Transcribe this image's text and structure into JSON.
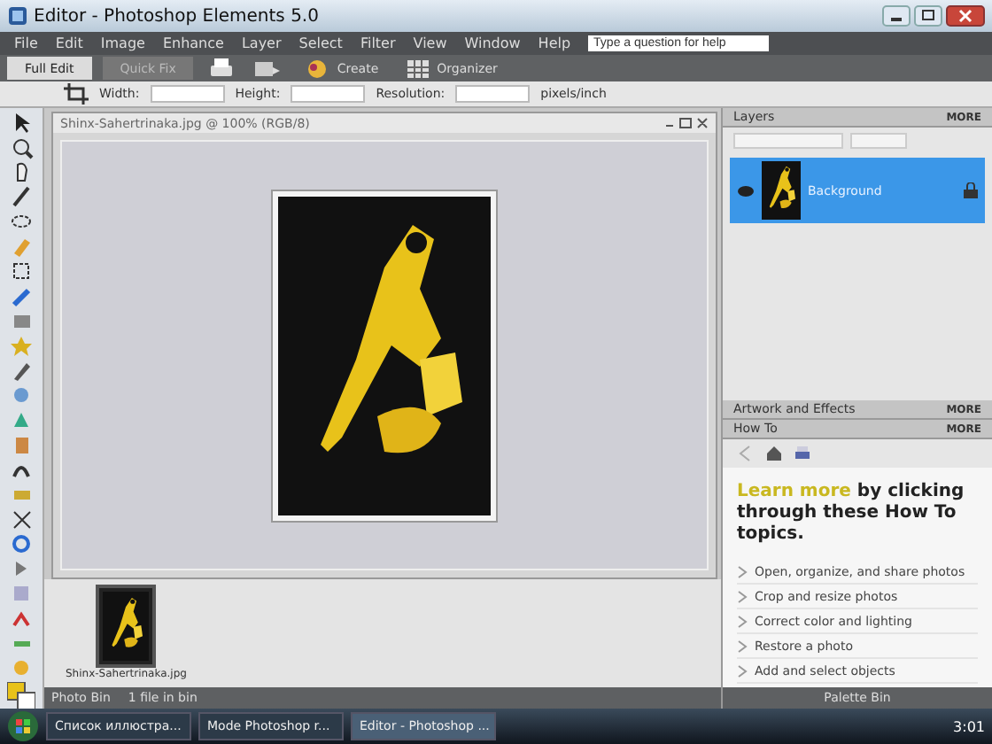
{
  "window": {
    "title": "Editor - Photoshop Elements 5.0"
  },
  "menu": [
    "File",
    "Edit",
    "Image",
    "Enhance",
    "Layer",
    "Select",
    "Filter",
    "View",
    "Window",
    "Help"
  ],
  "help_field": {
    "placeholder": "Type a question for help"
  },
  "modes": [
    {
      "label": "Full Edit",
      "selected": true
    },
    {
      "label": "Quick Fix",
      "selected": false
    }
  ],
  "shortcuts": [
    {
      "kind": "print"
    },
    {
      "kind": "share"
    },
    {
      "kind": "create",
      "label": "Create"
    },
    {
      "kind": "organizer",
      "label": "Organizer"
    }
  ],
  "options": [
    "Width:",
    "Height:",
    "Resolution:",
    "pixels/inch"
  ],
  "document": {
    "title": "Shinx-Sahertrinaka.jpg @ 100% (RGB/8)"
  },
  "photo_bin": {
    "thumbnails": [
      {
        "caption": "Shinx-Sahertrinaka.jpg",
        "selected": true
      }
    ],
    "label": "Photo Bin",
    "count": "1 file in bin"
  },
  "layers_panel": {
    "title": "Layers",
    "more": "MORE",
    "layers": [
      {
        "name": "Background",
        "selected": true,
        "visible": true,
        "locked": true
      }
    ]
  },
  "artwork_panel": {
    "title": "Artwork and Effects",
    "more": "MORE"
  },
  "howto_panel": {
    "title": "How To",
    "more": "MORE",
    "intro_link": "Learn more",
    "intro": "by clicking through these How To topics.",
    "topics": [
      "Open, organize, and share photos",
      "Crop and resize photos",
      "Correct color and lighting",
      "Restore a photo",
      "Add and select objects"
    ]
  },
  "palette_bin": {
    "label": "Palette Bin"
  },
  "taskbar": {
    "buttons": [
      {
        "label": "Список иллюстра...",
        "selected": false
      },
      {
        "label": "Mode Photoshop r...",
        "selected": false
      },
      {
        "label": "Editor - Photoshop ...",
        "selected": true
      }
    ],
    "clock": "3:01"
  }
}
